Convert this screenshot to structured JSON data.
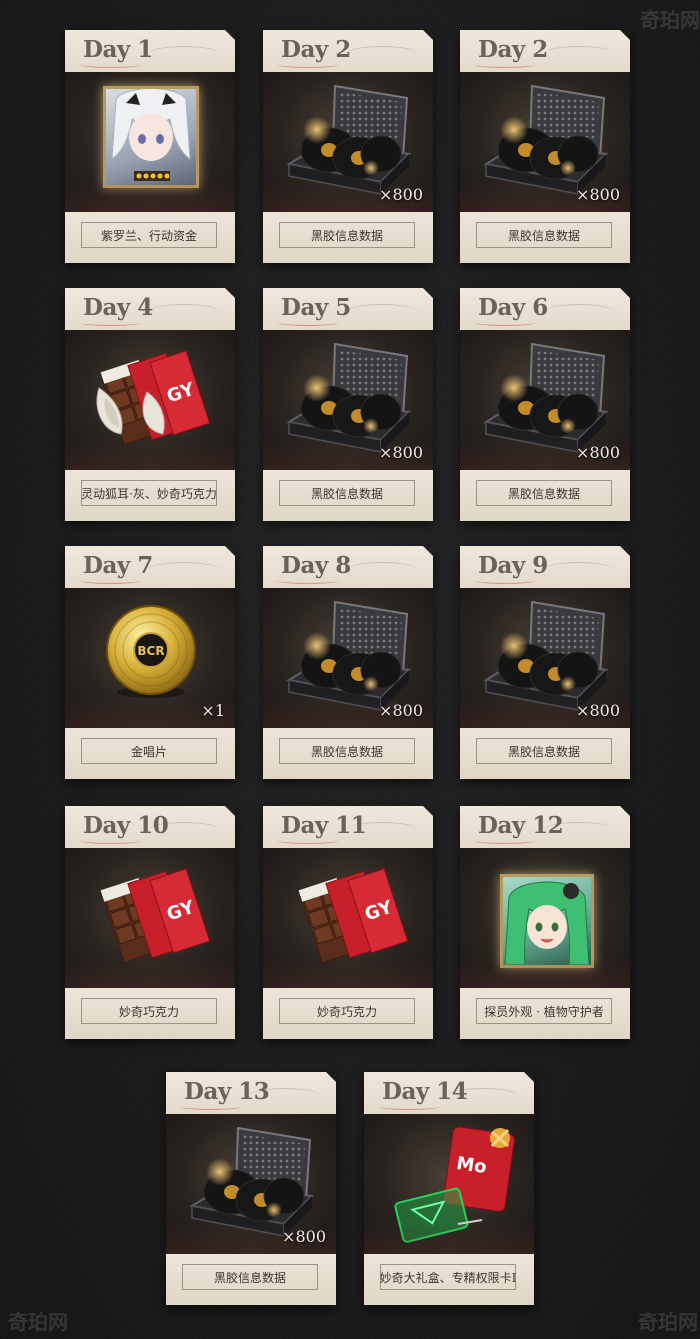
{
  "watermarks": {
    "top_right": "奇珀网",
    "bottom_left": "奇珀网",
    "bottom_right": "奇珀网"
  },
  "cards": [
    {
      "day": "Day 1",
      "label": "紫罗兰、行动资金",
      "qty": "",
      "item": "portrait-silver"
    },
    {
      "day": "Day 2",
      "label": "黑胶信息数据",
      "qty": "×800",
      "item": "vinyl-case"
    },
    {
      "day": "Day 2",
      "label": "黑胶信息数据",
      "qty": "×800",
      "item": "vinyl-case"
    },
    {
      "day": "Day 4",
      "label": "灵动狐耳·灰、妙奇巧克力",
      "qty": "",
      "item": "fox-ears-chocolate"
    },
    {
      "day": "Day 5",
      "label": "黑胶信息数据",
      "qty": "×800",
      "item": "vinyl-case"
    },
    {
      "day": "Day 6",
      "label": "黑胶信息数据",
      "qty": "×800",
      "item": "vinyl-case"
    },
    {
      "day": "Day 7",
      "label": "金唱片",
      "qty": "×1",
      "item": "gold-record"
    },
    {
      "day": "Day 8",
      "label": "黑胶信息数据",
      "qty": "×800",
      "item": "vinyl-case"
    },
    {
      "day": "Day 9",
      "label": "黑胶信息数据",
      "qty": "×800",
      "item": "vinyl-case"
    },
    {
      "day": "Day 10",
      "label": "妙奇巧克力",
      "qty": "",
      "item": "chocolate"
    },
    {
      "day": "Day 11",
      "label": "妙奇巧克力",
      "qty": "",
      "item": "chocolate"
    },
    {
      "day": "Day 12",
      "label": "探员外观 · 植物守护者",
      "qty": "",
      "item": "portrait-green"
    },
    {
      "day": "Day 13",
      "label": "黑胶信息数据",
      "qty": "×800",
      "item": "vinyl-case"
    },
    {
      "day": "Day 14",
      "label": "妙奇大礼盒、专精权限卡Ⅰ",
      "qty": "",
      "item": "gift-box-card"
    }
  ],
  "logo_text": {
    "record": "BCR",
    "chocolate": "GY"
  },
  "colors": {
    "paper": "#ece5d8",
    "day_text": "#6a6359",
    "gold": "#c9a23b",
    "chocolate_red": "#c7202a",
    "card_green": "#27d35a"
  }
}
